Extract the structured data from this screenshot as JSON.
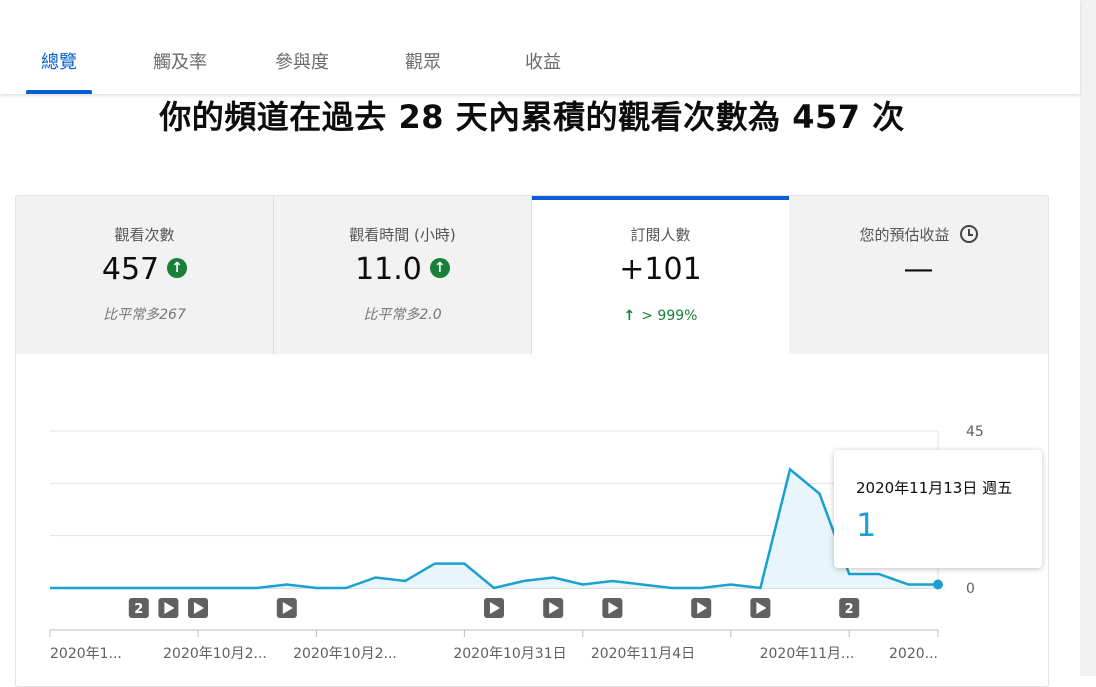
{
  "tabs": [
    {
      "label": "總覽",
      "active": true
    },
    {
      "label": "觸及率"
    },
    {
      "label": "參與度"
    },
    {
      "label": "觀眾"
    },
    {
      "label": "收益"
    }
  ],
  "headline": {
    "prefix": "你的頻道在過去 ",
    "days": "28",
    "middle": " 天內累積的觀看次數為 ",
    "views": "457",
    "suffix": " 次"
  },
  "metrics": [
    {
      "label": "觀看次數",
      "value": "457",
      "comparison": "比平常多267",
      "trend_icon": "arrow-up-circle-icon"
    },
    {
      "label": "觀看時間 (小時)",
      "value": "11.0",
      "comparison": "比平常多2.0",
      "trend_icon": "arrow-up-circle-icon"
    },
    {
      "label": "訂閱人數",
      "value": "+101",
      "trend_arrow": "↑",
      "trend_text": "> 999%",
      "active": true
    },
    {
      "label": "您的預估收益",
      "value": "—",
      "icon": "clock-icon"
    }
  ],
  "tooltip": {
    "date": "2020年11月13日 週五",
    "value": "1"
  },
  "colors": {
    "accent": "#065fd4",
    "line": "#1ba1cf",
    "positive": "#188038",
    "area": "#e8f5fa"
  },
  "chart_data": {
    "type": "area",
    "y_ticks": [
      "45",
      "0"
    ],
    "ylim": [
      0,
      45
    ],
    "x_labels": [
      "2020年1...",
      "2020年10月2...",
      "2020年10月2...",
      "2020年10月31日",
      "2020年11月4日",
      "2020年11月...",
      "2020..."
    ],
    "values": [
      0,
      0,
      0,
      0,
      0,
      0,
      0,
      0,
      1,
      0,
      0,
      3,
      2,
      7,
      7,
      0,
      2,
      3,
      1,
      2,
      1,
      0,
      0,
      1,
      0,
      34,
      27,
      4,
      4,
      1,
      1
    ],
    "markers": [
      {
        "index": 3,
        "label": "2"
      },
      {
        "index": 4,
        "icon": "play-icon"
      },
      {
        "index": 5,
        "icon": "play-icon"
      },
      {
        "index": 8,
        "icon": "play-icon"
      },
      {
        "index": 15,
        "icon": "play-icon"
      },
      {
        "index": 17,
        "icon": "play-icon"
      },
      {
        "index": 19,
        "icon": "play-icon"
      },
      {
        "index": 22,
        "icon": "play-icon"
      },
      {
        "index": 24,
        "icon": "play-icon"
      },
      {
        "index": 27,
        "label": "2"
      }
    ]
  }
}
